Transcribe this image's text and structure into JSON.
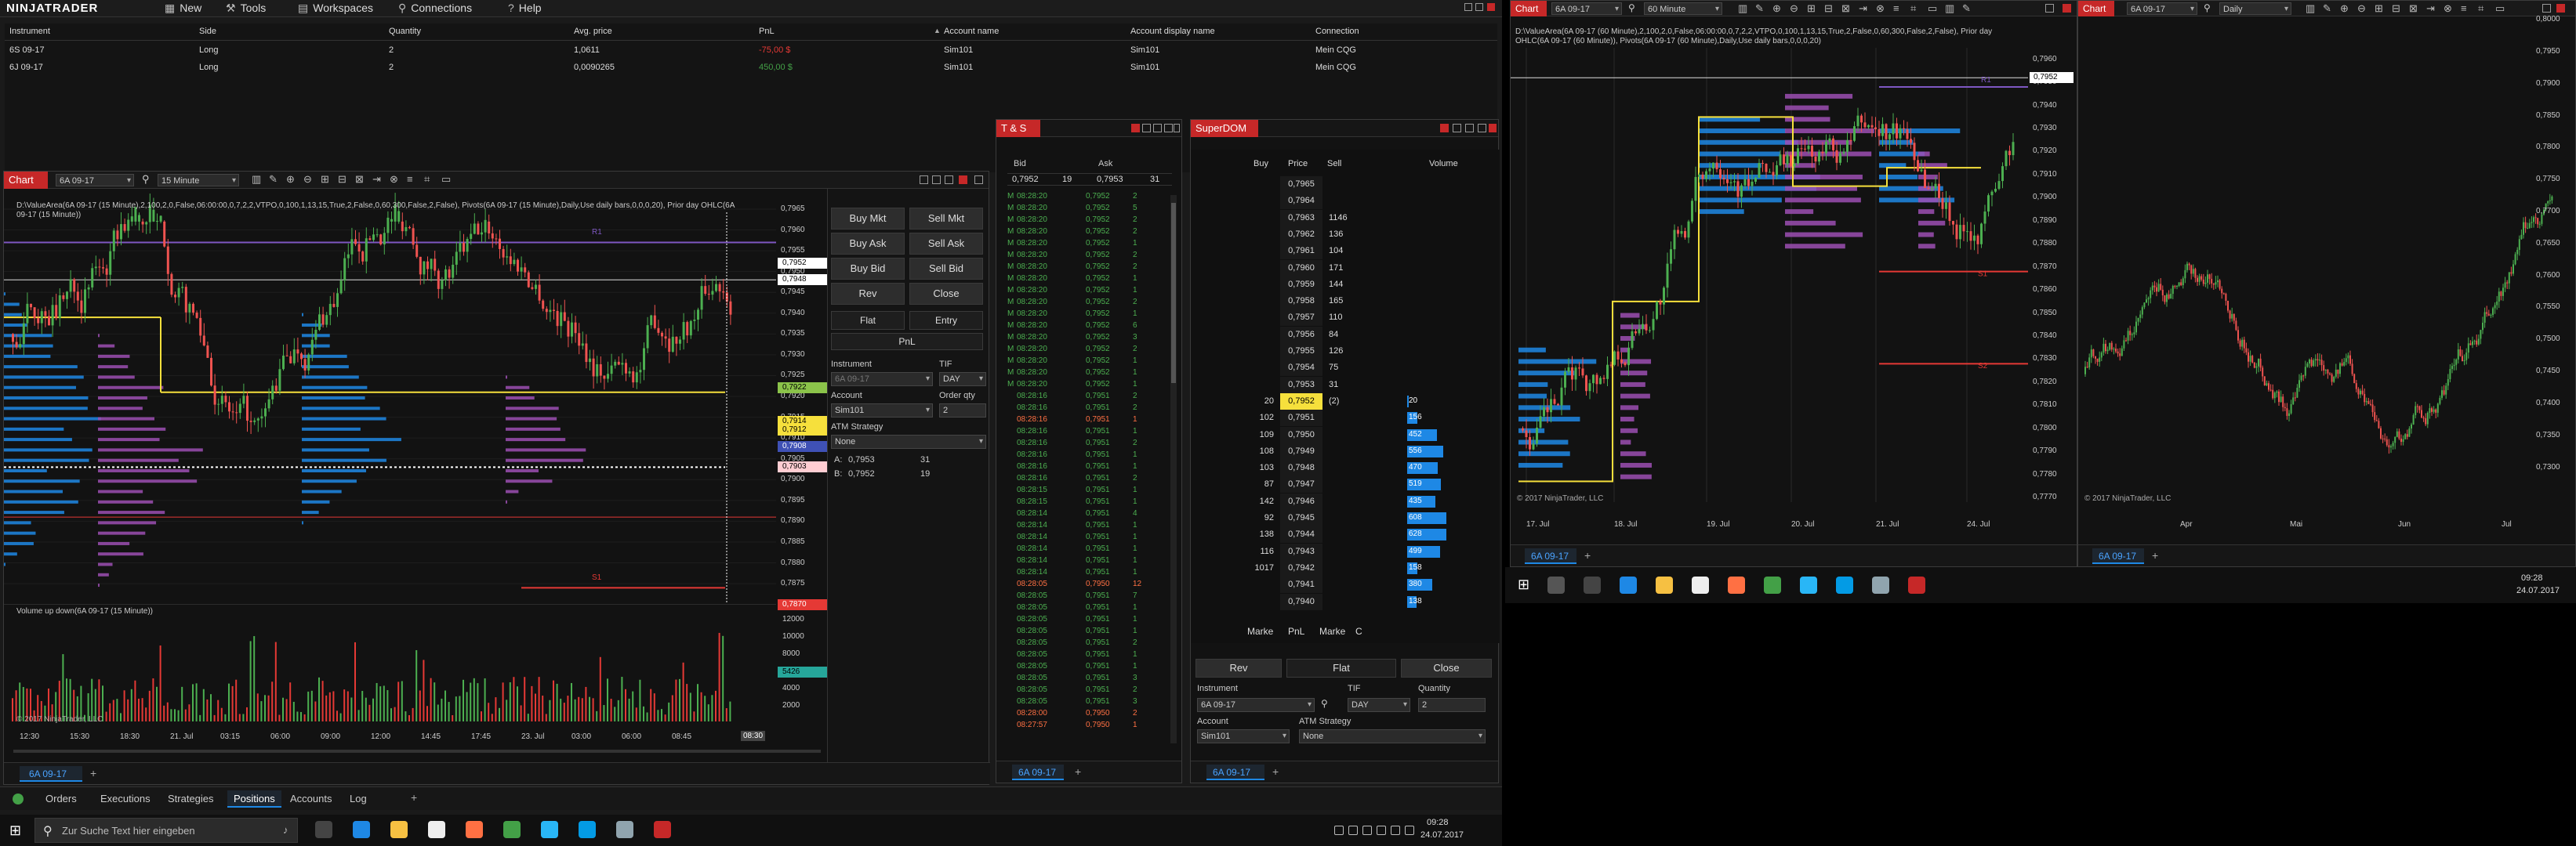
{
  "menu": {
    "logo": "NINJATRADER",
    "items": [
      {
        "icon": "new-icon",
        "label": "New"
      },
      {
        "icon": "tools-icon",
        "label": "Tools"
      },
      {
        "icon": "workspaces-icon",
        "label": "Workspaces"
      },
      {
        "icon": "connections-icon",
        "label": "Connections"
      },
      {
        "icon": "help-icon",
        "label": "Help"
      }
    ]
  },
  "positions": {
    "columns": [
      "Instrument",
      "Side",
      "Quantity",
      "Avg. price",
      "PnL",
      "Account name",
      "Account display name",
      "Connection"
    ],
    "rows": [
      [
        "6S 09-17",
        "Long",
        "2",
        "1,0611",
        "-75,00 $",
        "Sim101",
        "Sim101",
        "Mein CQG"
      ],
      [
        "6J 09-17",
        "Long",
        "2",
        "0,0090265",
        "450,00 $",
        "Sim101",
        "Sim101",
        "Mein CQG"
      ]
    ],
    "pnl_colors": [
      "#e53935",
      "#43a047"
    ]
  },
  "chart1": {
    "title": "Chart",
    "instrument": "6A 09-17",
    "interval": "15 Minute",
    "header_line": "D:\\ValueArea(6A 09-17 (15 Minute),2,100,2,0,False,06:00:00,0,7,2,2,VTPO,0,100,1,13,15,True,2,False,0,60,300,False,2,False), Pivots(6A 09-17 (15 Minute),Daily,Use daily bars,0,0,0,20), Prior day OHLC(6A",
    "header_line2": "09-17 (15 Minute))",
    "y_ticks": [
      "0,7965",
      "0,7960",
      "0,7955",
      "0,7950",
      "0,7945",
      "0,7940",
      "0,7935",
      "0,7930",
      "0,7925",
      "0,7920",
      "0,7915",
      "0,7910",
      "0,7905",
      "0,7900",
      "0,7895",
      "0,7890",
      "0,7885",
      "0,7880",
      "0,7875"
    ],
    "price_flags": [
      {
        "label": "0,7952",
        "bg": "#ffffff",
        "fg": "#000000"
      },
      {
        "label": "0,7948",
        "bg": "#ffffff",
        "fg": "#000000"
      },
      {
        "label": "0,7922",
        "bg": "#8bc34a",
        "fg": "#000000"
      },
      {
        "label": "0,7914",
        "bg": "#f6e03c",
        "fg": "#000000"
      },
      {
        "label": "0,7912",
        "bg": "#f6e03c",
        "fg": "#000000"
      },
      {
        "label": "0,7908",
        "bg": "#3f51b5",
        "fg": "#ffffff"
      },
      {
        "label": "0,7903",
        "bg": "#ffcdd2",
        "fg": "#000000"
      },
      {
        "label": "0,7870",
        "bg": "#e53935",
        "fg": "#ffffff"
      }
    ],
    "r_labels": [
      "R1",
      "S1"
    ],
    "x_ticks": [
      "12:30",
      "15:30",
      "18:30",
      "21. Jul",
      "03:15",
      "06:00",
      "09:00",
      "12:00",
      "14:45",
      "17:45",
      "23. Jul",
      "03:00",
      "06:00",
      "08:45"
    ],
    "current_time": "08:30",
    "vol_label": "Volume up down(6A 09-17 (15 Minute))",
    "vol_ticks": [
      "12000",
      "10000",
      "8000",
      "6000",
      "4000",
      "2000"
    ],
    "vol_flag": "5426",
    "copyright": "© 2017 NinjaTrader, LLC",
    "tab": "6A 09-17"
  },
  "chart_trader": {
    "buy_mkt": "Buy Mkt",
    "sell_mkt": "Sell Mkt",
    "buy_ask": "Buy Ask",
    "sell_ask": "Sell Ask",
    "buy_bid": "Buy Bid",
    "sell_bid": "Sell Bid",
    "rev": "Rev",
    "close": "Close",
    "flat": "Flat",
    "entry": "Entry",
    "pnl": "PnL",
    "instrument_label": "Instrument",
    "instrument": "6A 09-17",
    "tif_label": "TIF",
    "tif": "DAY",
    "account_label": "Account",
    "account": "Sim101",
    "orderqty_label": "Order qty",
    "orderqty": "2",
    "atm_label": "ATM Strategy",
    "atm": "None",
    "a_label": "A:",
    "a_price": "0,7953",
    "a_size": "31",
    "b_label": "B:",
    "b_price": "0,7952",
    "b_size": "19"
  },
  "ts": {
    "title": "T & S",
    "bid_label": "Bid",
    "ask_label": "Ask",
    "bid_price": "0,7952",
    "bid_size": "19",
    "ask_price": "0,7953",
    "ask_size": "31",
    "tab": "6A 09-17",
    "rows": [
      [
        "M",
        "08:28:20",
        "0,7952",
        "2",
        "g"
      ],
      [
        "M",
        "08:28:20",
        "0,7952",
        "5",
        "g"
      ],
      [
        "M",
        "08:28:20",
        "0,7952",
        "2",
        "g"
      ],
      [
        "M",
        "08:28:20",
        "0,7952",
        "2",
        "g"
      ],
      [
        "M",
        "08:28:20",
        "0,7952",
        "1",
        "g"
      ],
      [
        "M",
        "08:28:20",
        "0,7952",
        "2",
        "g"
      ],
      [
        "M",
        "08:28:20",
        "0,7952",
        "2",
        "g"
      ],
      [
        "M",
        "08:28:20",
        "0,7952",
        "1",
        "g"
      ],
      [
        "M",
        "08:28:20",
        "0,7952",
        "1",
        "g"
      ],
      [
        "M",
        "08:28:20",
        "0,7952",
        "2",
        "g"
      ],
      [
        "M",
        "08:28:20",
        "0,7952",
        "1",
        "g"
      ],
      [
        "M",
        "08:28:20",
        "0,7952",
        "6",
        "g"
      ],
      [
        "M",
        "08:28:20",
        "0,7952",
        "3",
        "g"
      ],
      [
        "M",
        "08:28:20",
        "0,7952",
        "2",
        "g"
      ],
      [
        "M",
        "08:28:20",
        "0,7952",
        "1",
        "g"
      ],
      [
        "M",
        "08:28:20",
        "0,7952",
        "1",
        "g"
      ],
      [
        "M",
        "08:28:20",
        "0,7952",
        "1",
        "g"
      ],
      [
        "",
        "08:28:16",
        "0,7951",
        "2",
        "g"
      ],
      [
        "",
        "08:28:16",
        "0,7951",
        "2",
        "g"
      ],
      [
        "",
        "08:28:16",
        "0,7951",
        "1",
        "o"
      ],
      [
        "",
        "08:28:16",
        "0,7951",
        "1",
        "g"
      ],
      [
        "",
        "08:28:16",
        "0,7951",
        "2",
        "g"
      ],
      [
        "",
        "08:28:16",
        "0,7951",
        "1",
        "g"
      ],
      [
        "",
        "08:28:16",
        "0,7951",
        "1",
        "g"
      ],
      [
        "",
        "08:28:16",
        "0,7951",
        "2",
        "g"
      ],
      [
        "",
        "08:28:15",
        "0,7951",
        "1",
        "g"
      ],
      [
        "",
        "08:28:15",
        "0,7951",
        "1",
        "g"
      ],
      [
        "",
        "08:28:14",
        "0,7951",
        "4",
        "g"
      ],
      [
        "",
        "08:28:14",
        "0,7951",
        "1",
        "g"
      ],
      [
        "",
        "08:28:14",
        "0,7951",
        "1",
        "g"
      ],
      [
        "",
        "08:28:14",
        "0,7951",
        "1",
        "g"
      ],
      [
        "",
        "08:28:14",
        "0,7951",
        "1",
        "g"
      ],
      [
        "",
        "08:28:14",
        "0,7951",
        "1",
        "g"
      ],
      [
        "",
        "08:28:05",
        "0,7950",
        "12",
        "o"
      ],
      [
        "",
        "08:28:05",
        "0,7951",
        "7",
        "g"
      ],
      [
        "",
        "08:28:05",
        "0,7951",
        "1",
        "g"
      ],
      [
        "",
        "08:28:05",
        "0,7951",
        "1",
        "g"
      ],
      [
        "",
        "08:28:05",
        "0,7951",
        "1",
        "g"
      ],
      [
        "",
        "08:28:05",
        "0,7951",
        "2",
        "g"
      ],
      [
        "",
        "08:28:05",
        "0,7951",
        "1",
        "g"
      ],
      [
        "",
        "08:28:05",
        "0,7951",
        "1",
        "g"
      ],
      [
        "",
        "08:28:05",
        "0,7951",
        "3",
        "g"
      ],
      [
        "",
        "08:28:05",
        "0,7951",
        "2",
        "g"
      ],
      [
        "",
        "08:28:05",
        "0,7951",
        "3",
        "g"
      ],
      [
        "",
        "08:28:00",
        "0,7950",
        "2",
        "o"
      ],
      [
        "",
        "08:27:57",
        "0,7950",
        "1",
        "o"
      ]
    ]
  },
  "dom": {
    "title": "SuperDOM",
    "col_buy": "Buy",
    "col_price": "Price",
    "col_sell": "Sell",
    "col_volume": "Volume",
    "rows": [
      [
        "",
        "0,7965",
        "",
        ""
      ],
      [
        "",
        "0,7964",
        "",
        ""
      ],
      [
        "",
        "0,7963",
        "1146",
        ""
      ],
      [
        "",
        "0,7962",
        "136",
        ""
      ],
      [
        "",
        "0,7961",
        "104",
        ""
      ],
      [
        "",
        "0,7960",
        "171",
        ""
      ],
      [
        "",
        "0,7959",
        "144",
        ""
      ],
      [
        "",
        "0,7958",
        "165",
        ""
      ],
      [
        "",
        "0,7957",
        "110",
        ""
      ],
      [
        "",
        "0,7956",
        "84",
        ""
      ],
      [
        "",
        "0,7955",
        "126",
        ""
      ],
      [
        "",
        "0,7954",
        "75",
        ""
      ],
      [
        "",
        "0,7953",
        "31",
        ""
      ],
      [
        "20",
        "0,7952",
        "(2)",
        "20"
      ],
      [
        "102",
        "0,7951",
        "",
        "156"
      ],
      [
        "109",
        "0,7950",
        "",
        "452"
      ],
      [
        "108",
        "0,7949",
        "",
        "556"
      ],
      [
        "103",
        "0,7948",
        "",
        "470"
      ],
      [
        "87",
        "0,7947",
        "",
        "519"
      ],
      [
        "142",
        "0,7946",
        "",
        "435"
      ],
      [
        "92",
        "0,7945",
        "",
        "608"
      ],
      [
        "138",
        "0,7944",
        "",
        "628"
      ],
      [
        "116",
        "0,7943",
        "",
        "499"
      ],
      [
        "1017",
        "0,7942",
        "",
        "158"
      ],
      [
        "",
        "0,7941",
        "",
        "380"
      ],
      [
        "",
        "0,7940",
        "",
        "138"
      ]
    ],
    "marker_buy": "Marke",
    "marker_pnl": "PnL",
    "marker_sell": "Marke",
    "marker_c": "C",
    "rev": "Rev",
    "flat": "Flat",
    "close": "Close",
    "instrument_label": "Instrument",
    "instrument": "6A 09-17",
    "tif_label": "TIF",
    "tif": "DAY",
    "qty_label": "Quantity",
    "qty": "2",
    "account_label": "Account",
    "account": "Sim101",
    "atm_label": "ATM Strategy",
    "atm": "None",
    "tab": "6A 09-17"
  },
  "chart2": {
    "title": "Chart",
    "instrument": "6A 09-17",
    "interval": "60 Minute",
    "header_line": "D:\\ValueArea(6A 09-17 (60 Minute),2,100,2,0,False,06:00:00,0,7,2,2,VTPO,0,100,1,13,15,True,2,False,0,60,300,False,2,False), Prior day",
    "header_line2": "OHLC(6A 09-17 (60 Minute)), Pivots(6A 09-17 (60 Minute),Daily,Use daily bars,0,0,0,20)",
    "y_ticks": [
      "0,7960",
      "0,7950",
      "0,7940",
      "0,7930",
      "0,7920",
      "0,7910",
      "0,7900",
      "0,7890",
      "0,7880",
      "0,7870",
      "0,7860",
      "0,7850",
      "0,7840",
      "0,7830",
      "0,7820",
      "0,7810",
      "0,7800",
      "0,7790",
      "0,7780",
      "0,7770"
    ],
    "flag": "0,7952",
    "x_ticks": [
      "17. Jul",
      "18. Jul",
      "19. Jul",
      "20. Jul",
      "21. Jul",
      "24. Jul"
    ],
    "labels": [
      "R1",
      "S1",
      "S2"
    ],
    "copyright": "© 2017 NinjaTrader, LLC",
    "tab": "6A 09-17"
  },
  "chart3": {
    "title": "Chart",
    "instrument": "6A 09-17",
    "interval": "Daily",
    "y_ticks": [
      "0,8000",
      "0,7950",
      "0,7900",
      "0,7850",
      "0,7800",
      "0,7750",
      "0,7700",
      "0,7650",
      "0,7600",
      "0,7550",
      "0,7500",
      "0,7450",
      "0,7400",
      "0,7350",
      "0,7300"
    ],
    "x_ticks": [
      "Apr",
      "Mai",
      "Jun",
      "Jul"
    ],
    "copyright": "© 2017 NinjaTrader, LLC",
    "tab": "6A 09-17"
  },
  "bottom_tabs": [
    "Orders",
    "Executions",
    "Strategies",
    "Positions",
    "Accounts",
    "Log"
  ],
  "bottom_active": "Positions",
  "taskbar_left": {
    "search": "Zur Suche Text hier eingeben",
    "time": "09:28",
    "date": "24.07.2017"
  },
  "taskbar_right": {
    "time": "09:28",
    "date": "24.07.2017"
  },
  "colors": {
    "accent": "#e53935",
    "window_bg": "#121212",
    "blue_profile": "#1e88e5",
    "purple_profile": "#9c4fb3",
    "up": "#4caf50",
    "down": "#ef5350"
  }
}
